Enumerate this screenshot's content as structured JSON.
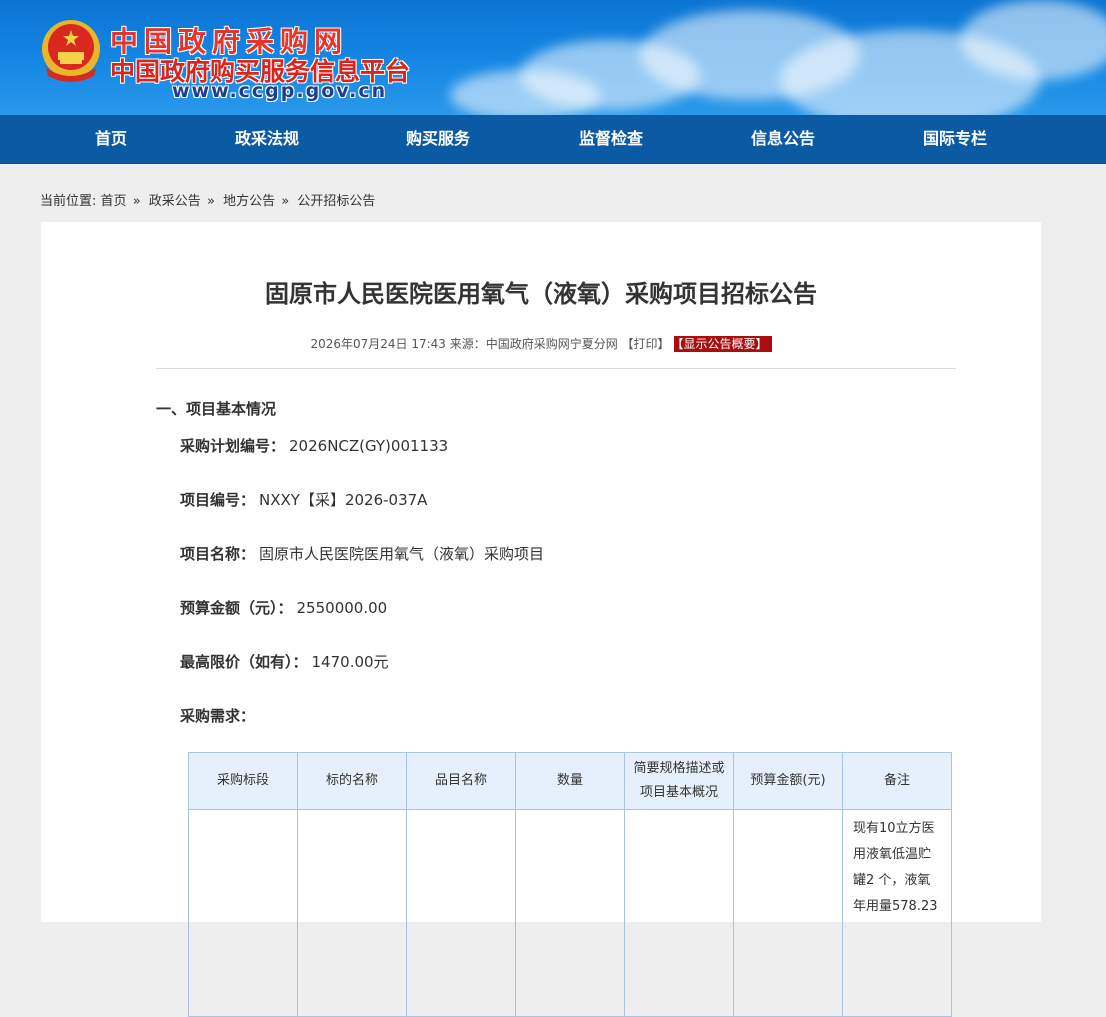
{
  "header": {
    "title": "中国政府采购网",
    "subtitle": "中国政府购买服务信息平台",
    "url": "www.ccgp.gov.cn"
  },
  "nav": [
    "首页",
    "政采法规",
    "购买服务",
    "监督检查",
    "信息公告",
    "国际专栏"
  ],
  "breadcrumb": {
    "prefix": "当前位置:",
    "items": [
      "首页",
      "政采公告",
      "地方公告",
      "公开招标公告"
    ],
    "separator": "»"
  },
  "article": {
    "title": "固原市人民医院医用氧气（液氧）采购项目招标公告",
    "meta": "2026年07月24日 17:43 来源：中国政府采购网宁夏分网 【打印】",
    "badge": "【显示公告概要】",
    "section1": "一、项目基本情况",
    "fields": [
      {
        "k": "采购计划编号：",
        "v": "2026NCZ(GY)001133"
      },
      {
        "k": "项目编号：",
        "v": "NXXY【采】2026-037A"
      },
      {
        "k": "项目名称：",
        "v": "固原市人民医院医用氧气（液氧）采购项目"
      },
      {
        "k": "预算金额（元）：",
        "v": "2550000.00"
      },
      {
        "k": "最高限价（如有）：",
        "v": "1470.00元"
      },
      {
        "k": "采购需求：",
        "v": ""
      }
    ]
  },
  "table": {
    "headers": [
      "采购标段",
      "标的名称",
      "品目名称",
      "数量",
      "简要规格描述或项目基本概况",
      "预算金额(元)",
      "备注"
    ],
    "note_lines": [
      "现有10立方医",
      "用液氧低温贮",
      "罐2 个，液氧",
      "年用量578.23"
    ]
  },
  "colors": {
    "nav": "#0c5aa3",
    "header": "#1587e4",
    "badge": "#a80e0e",
    "table_header": "#e6f0fc"
  }
}
